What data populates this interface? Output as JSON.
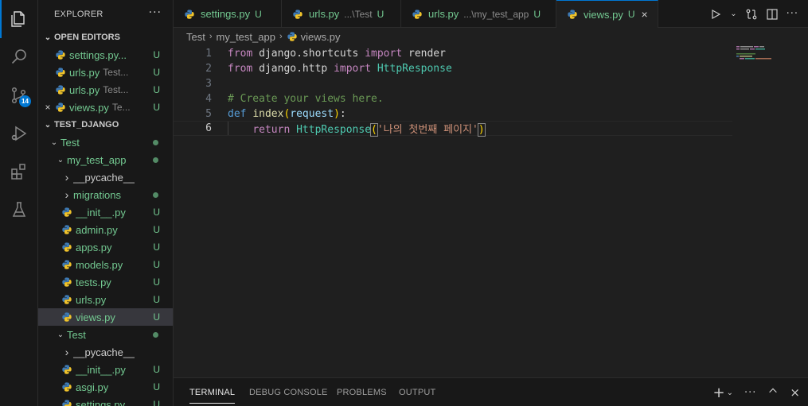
{
  "activity_bar": {
    "items": [
      {
        "icon": "explorer-icon",
        "active": true
      },
      {
        "icon": "search-icon"
      },
      {
        "icon": "source-control-icon",
        "badge": "14"
      },
      {
        "icon": "run-debug-icon"
      },
      {
        "icon": "extensions-icon"
      },
      {
        "icon": "testing-icon"
      }
    ]
  },
  "sidebar": {
    "title": "EXPLORER",
    "more": "···",
    "open_editors": {
      "label": "OPEN EDITORS",
      "items": [
        {
          "name": "settings.py...",
          "desc": "",
          "status": "U"
        },
        {
          "name": "urls.py",
          "desc": "Test...",
          "status": "U"
        },
        {
          "name": "urls.py",
          "desc": "Test...",
          "status": "U"
        },
        {
          "name": "views.py",
          "desc": "Te...",
          "status": "U",
          "close": "×"
        }
      ]
    },
    "workspace": {
      "label": "TEST_DJANGO",
      "tree": [
        {
          "name": "Test",
          "kind": "folder-open",
          "status": "dot"
        },
        {
          "name": "my_test_app",
          "kind": "folder-open",
          "status": "dot"
        },
        {
          "name": "__pycache__",
          "kind": "folder-closed",
          "status": ""
        },
        {
          "name": "migrations",
          "kind": "folder-closed",
          "status": "dot"
        },
        {
          "name": "__init__.py",
          "kind": "file",
          "status": "U"
        },
        {
          "name": "admin.py",
          "kind": "file",
          "status": "U"
        },
        {
          "name": "apps.py",
          "kind": "file",
          "status": "U"
        },
        {
          "name": "models.py",
          "kind": "file",
          "status": "U"
        },
        {
          "name": "tests.py",
          "kind": "file",
          "status": "U"
        },
        {
          "name": "urls.py",
          "kind": "file",
          "status": "U"
        },
        {
          "name": "views.py",
          "kind": "file",
          "status": "U",
          "selected": true
        },
        {
          "name": "Test",
          "kind": "folder-open",
          "status": "dot"
        },
        {
          "name": "__pycache__",
          "kind": "folder-closed",
          "status": ""
        },
        {
          "name": "__init__.py",
          "kind": "file",
          "status": "U"
        },
        {
          "name": "asgi.py",
          "kind": "file",
          "status": "U"
        },
        {
          "name": "settings.py",
          "kind": "file",
          "status": "U"
        }
      ]
    }
  },
  "tabs": [
    {
      "name": "settings.py",
      "desc": "",
      "status": "U"
    },
    {
      "name": "urls.py",
      "desc": "...\\Test",
      "status": "U"
    },
    {
      "name": "urls.py",
      "desc": "...\\my_test_app",
      "status": "U"
    },
    {
      "name": "views.py",
      "desc": "",
      "status": "U",
      "active": true,
      "close": "×"
    }
  ],
  "breadcrumb": {
    "parts": [
      "Test",
      "my_test_app",
      "views.py"
    ],
    "sep": "›"
  },
  "editor": {
    "line_numbers": [
      "1",
      "2",
      "3",
      "4",
      "5",
      "6"
    ],
    "current_line": "6",
    "lines": {
      "l1": {
        "kw1": "from",
        "mod": " django.shortcuts ",
        "kw2": "import",
        "name": " render"
      },
      "l2": {
        "kw1": "from",
        "mod": " django.http ",
        "kw2": "import",
        "name": " HttpResponse"
      },
      "l4": {
        "comment": "# Create your views here."
      },
      "l5": {
        "def": "def",
        "fn": "index",
        "open": "(",
        "param": "request",
        "close": ")",
        "colon": ":"
      },
      "l6": {
        "indent": "    ",
        "ret": "return",
        "cls": " HttpResponse",
        "open": "(",
        "str": "'나의 첫번째 페이지'",
        "close": ")"
      }
    }
  },
  "panel": {
    "tabs": [
      "TERMINAL",
      "DEBUG CONSOLE",
      "PROBLEMS",
      "OUTPUT"
    ],
    "active": "TERMINAL"
  }
}
